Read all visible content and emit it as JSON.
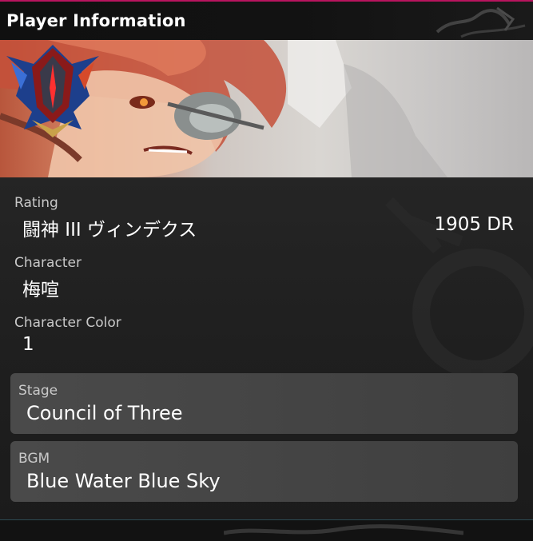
{
  "header": {
    "title": "Player Information"
  },
  "banner": {
    "emblem_icon": "rank-emblem-icon"
  },
  "rating": {
    "label": "Rating",
    "rank": "闘神 III ヴィンデクス",
    "points": "1905 DR"
  },
  "character": {
    "label": "Character",
    "value": "梅喧"
  },
  "character_color": {
    "label": "Character Color",
    "value": "1"
  },
  "stage": {
    "label": "Stage",
    "value": "Council of Three"
  },
  "bgm": {
    "label": "BGM",
    "value": "Blue Water Blue Sky"
  },
  "colors": {
    "accent": "#b8145e",
    "panel": "#474747",
    "background": "#1f1f1f"
  }
}
